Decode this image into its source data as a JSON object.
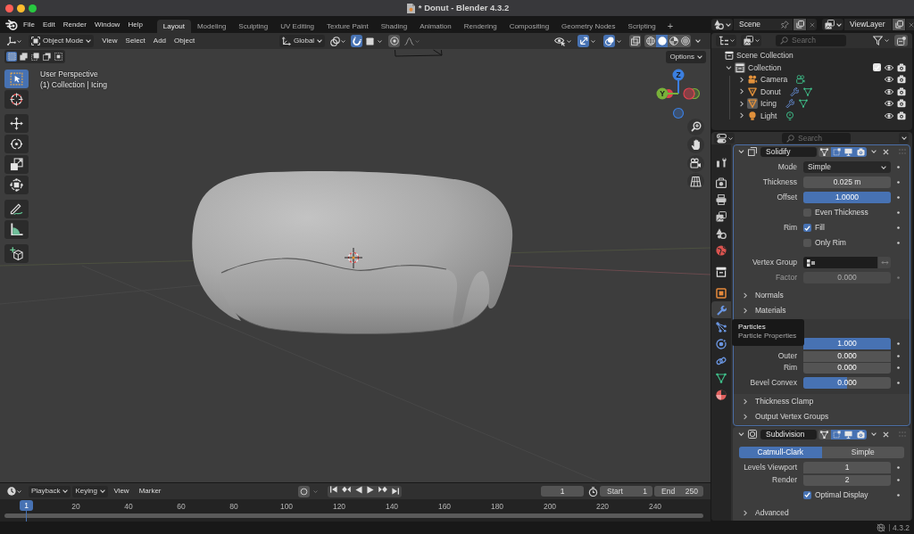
{
  "window": {
    "title": "* Donut - Blender 4.3.2"
  },
  "top_bar": {
    "menus": [
      "File",
      "Edit",
      "Render",
      "Window",
      "Help"
    ],
    "workspaces": [
      {
        "label": "Layout",
        "selected": true
      },
      {
        "label": "Modeling",
        "selected": false
      },
      {
        "label": "Sculpting",
        "selected": false
      },
      {
        "label": "UV Editing",
        "selected": false
      },
      {
        "label": "Texture Paint",
        "selected": false
      },
      {
        "label": "Shading",
        "selected": false
      },
      {
        "label": "Animation",
        "selected": false
      },
      {
        "label": "Rendering",
        "selected": false
      },
      {
        "label": "Compositing",
        "selected": false
      },
      {
        "label": "Geometry Nodes",
        "selected": false
      },
      {
        "label": "Scripting",
        "selected": false
      }
    ],
    "add_workspace": "+",
    "scene": "Scene",
    "view_layer": "ViewLayer"
  },
  "viewport": {
    "header": {
      "mode": "Object Mode",
      "menus": [
        "View",
        "Select",
        "Add",
        "Object"
      ],
      "orientation": "Global",
      "snap": true,
      "proportional_editing": false,
      "gizmos": true,
      "overlays": true,
      "xray": false,
      "shading": [
        {
          "kind": "wireframe",
          "selected": false
        },
        {
          "kind": "solid",
          "selected": true
        },
        {
          "kind": "material",
          "selected": false
        },
        {
          "kind": "rendered",
          "selected": false
        }
      ]
    },
    "select_modes": [
      {
        "kind": "set",
        "selected": true
      },
      {
        "kind": "extend",
        "selected": false
      },
      {
        "kind": "subtract",
        "selected": false
      },
      {
        "kind": "difference",
        "selected": false
      },
      {
        "kind": "intersect",
        "selected": false
      }
    ],
    "options": "Options",
    "info": [
      "User Perspective",
      "(1) Collection | Icing"
    ],
    "toolbar": [
      [
        {
          "kind": "select_box",
          "selected": true
        },
        {
          "kind": "cursor",
          "selected": false
        }
      ],
      [
        {
          "kind": "move",
          "selected": false
        },
        {
          "kind": "rotate",
          "selected": false
        },
        {
          "kind": "scale",
          "selected": false
        },
        {
          "kind": "transform",
          "selected": false
        }
      ],
      [
        {
          "kind": "annotate",
          "selected": false
        },
        {
          "kind": "measure",
          "selected": false
        }
      ],
      [
        {
          "kind": "add_cube",
          "selected": false
        }
      ]
    ],
    "gizmo": {
      "axes": [
        {
          "label": "Z",
          "color": "#3b7fe0"
        },
        {
          "label": "Y",
          "color": "#79b13a"
        },
        {
          "color": "#e0424f"
        }
      ]
    }
  },
  "outliner": {
    "search": {
      "placeholder": "Search"
    },
    "tree": [
      {
        "label": "Scene Collection",
        "kind": "scene_collection",
        "children": [
          {
            "label": "Collection",
            "kind": "collection",
            "expanded": true,
            "checked": true,
            "active": true,
            "children": [
              {
                "label": "Camera",
                "kind": "camera",
                "expanded": false,
                "active": false,
                "data": [
                  {
                    "kind": "camera"
                  }
                ]
              },
              {
                "label": "Donut",
                "kind": "mesh",
                "expanded": false,
                "active": false,
                "data": [
                  {
                    "kind": "modifier"
                  },
                  {
                    "kind": "mesh"
                  }
                ]
              },
              {
                "label": "Icing",
                "kind": "mesh",
                "expanded": false,
                "active": true,
                "data": [
                  {
                    "kind": "modifier"
                  },
                  {
                    "kind": "mesh"
                  }
                ]
              },
              {
                "label": "Light",
                "kind": "light",
                "expanded": false,
                "active": false,
                "data": [
                  {
                    "kind": "light"
                  }
                ]
              }
            ]
          }
        ]
      }
    ]
  },
  "properties": {
    "search": {
      "placeholder": "Search"
    },
    "tabs": [
      {
        "kind": "tool",
        "selected": false
      },
      {
        "kind": "render",
        "selected": false
      },
      {
        "kind": "output",
        "selected": false
      },
      {
        "kind": "view_layer",
        "selected": false
      },
      {
        "kind": "scene",
        "selected": false
      },
      {
        "kind": "world",
        "selected": false
      },
      {
        "kind": "collection",
        "selected": false
      },
      {
        "kind": "object",
        "selected": false
      },
      {
        "kind": "modifiers",
        "selected": true
      },
      {
        "kind": "particles",
        "selected": false
      },
      {
        "kind": "physics",
        "selected": false
      },
      {
        "kind": "constraints",
        "selected": false
      },
      {
        "kind": "data",
        "selected": false
      },
      {
        "kind": "material",
        "selected": false
      }
    ],
    "modifiers": [
      {
        "kind": "solidify",
        "name": "Solidify",
        "expanded": true,
        "active": true,
        "toggles": [
          {
            "kind": "edit_mode",
            "on": false
          },
          {
            "kind": "on_cage",
            "on": true
          },
          {
            "kind": "viewport",
            "on": true
          },
          {
            "kind": "render",
            "on": true
          }
        ],
        "rows": [
          {
            "kind": "dropdown",
            "label": "Mode",
            "value": "Simple"
          },
          {
            "kind": "number",
            "label": "Thickness",
            "value": "0.025 m"
          },
          {
            "kind": "slider",
            "label": "Offset",
            "value": "1.0000",
            "level": 1
          },
          {
            "kind": "checkbox",
            "text": "Even Thickness",
            "checked": false
          },
          {
            "kind": "checkbox",
            "label": "Rim",
            "text": "Fill",
            "checked": true
          },
          {
            "kind": "checkbox",
            "text": "Only Rim",
            "checked": false
          },
          {
            "kind": "vertex_group",
            "label": "Vertex Group"
          },
          {
            "kind": "number",
            "label": "Factor",
            "value": "0.000",
            "disabled": true
          },
          {
            "kind": "subpanel",
            "label": "Normals",
            "expanded": false
          },
          {
            "kind": "subpanel",
            "label": "Materials",
            "expanded": false
          },
          {
            "kind": "group",
            "rows": [
              {
                "kind": "slider",
                "value": "1.000",
                "level": 1
              },
              {
                "kind": "slider",
                "label": "Outer",
                "value": "0.000",
                "level": 0,
                "joined": true
              },
              {
                "kind": "slider",
                "label": "Rim",
                "value": "0.000",
                "level": 0,
                "joined": true
              },
              {
                "kind": "slider",
                "label": "Bevel Convex",
                "value": "0.000",
                "level": 0.5
              }
            ]
          },
          {
            "kind": "subpanel",
            "label": "Thickness Clamp",
            "expanded": false
          },
          {
            "kind": "subpanel",
            "label": "Output Vertex Groups",
            "expanded": false
          }
        ]
      },
      {
        "kind": "subdivision",
        "name": "Subdivision",
        "expanded": true,
        "active": false,
        "toggles": [
          {
            "kind": "edit_mode",
            "on": false
          },
          {
            "kind": "on_cage",
            "on": true
          },
          {
            "kind": "viewport",
            "on": true
          },
          {
            "kind": "render",
            "on": true
          }
        ],
        "rows": [
          {
            "kind": "segmented",
            "options": [
              {
                "label": "Catmull-Clark",
                "selected": true
              },
              {
                "label": "Simple",
                "selected": false
              }
            ]
          },
          {
            "kind": "number",
            "label": "Levels Viewport",
            "value": "1"
          },
          {
            "kind": "number",
            "label": "Render",
            "value": "2",
            "joined": true
          },
          {
            "kind": "checkbox",
            "text": "Optimal Display",
            "checked": true
          },
          {
            "kind": "subpanel",
            "label": "Advanced",
            "expanded": false
          }
        ]
      }
    ],
    "tooltip": {
      "title": "Particles",
      "description": "Particle Properties"
    }
  },
  "timeline": {
    "menus": [
      {
        "label": "Playback",
        "kind": "dropdown"
      },
      {
        "label": "Keying",
        "kind": "dropdown"
      },
      {
        "label": "View",
        "kind": "menu"
      },
      {
        "label": "Marker",
        "kind": "menu"
      }
    ],
    "auto_keying": false,
    "current_frame": "1",
    "start": {
      "label": "Start",
      "value": "1"
    },
    "end": {
      "label": "End",
      "value": "250"
    },
    "playhead": "1",
    "ruler": [
      "20",
      "40",
      "60",
      "80",
      "100",
      "120",
      "140",
      "160",
      "180",
      "200",
      "220",
      "240"
    ]
  },
  "status_bar": {
    "version": "4.3.2"
  }
}
